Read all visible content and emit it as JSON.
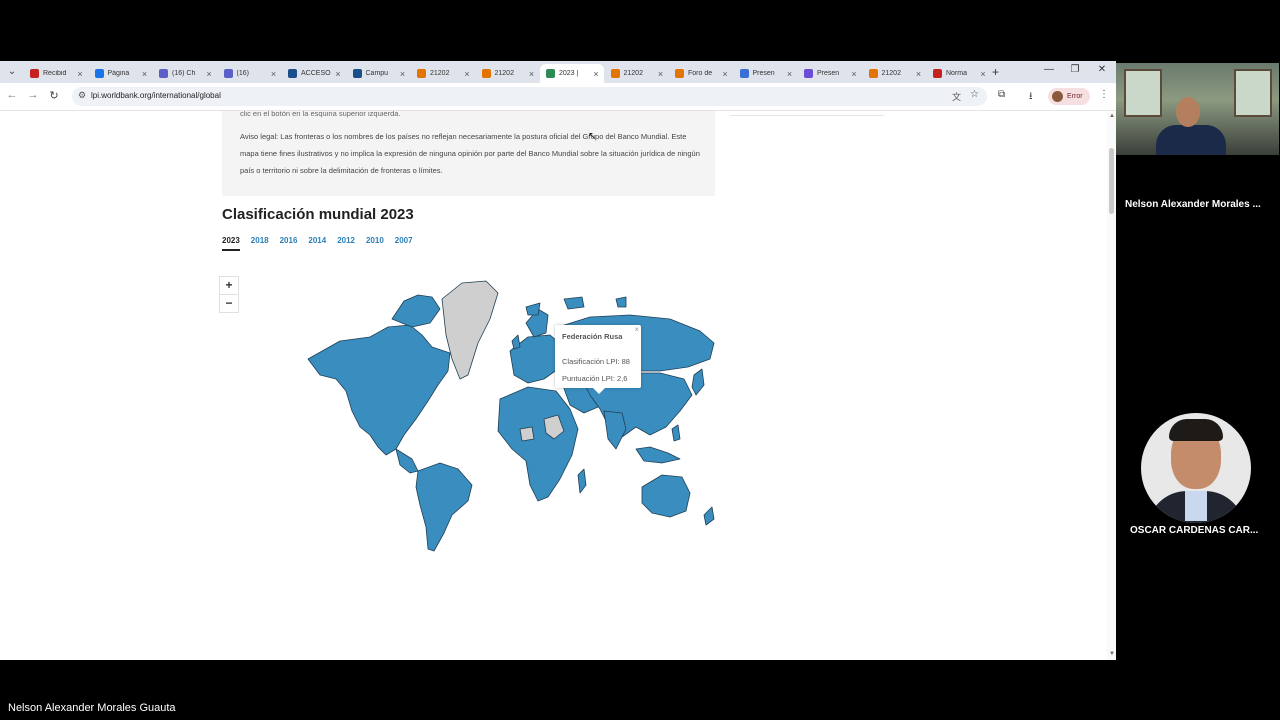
{
  "browser": {
    "tabs": [
      {
        "title": "Recibid",
        "color": "#c5221f"
      },
      {
        "title": "Página",
        "color": "#1a73e8"
      },
      {
        "title": "(16) Ch",
        "color": "#5b5fc7"
      },
      {
        "title": "(16)",
        "color": "#5b5fc7"
      },
      {
        "title": "ACCESO",
        "color": "#1a4f8a"
      },
      {
        "title": "Campu",
        "color": "#1a4f8a"
      },
      {
        "title": "21202",
        "color": "#e37400"
      },
      {
        "title": "21202",
        "color": "#e37400"
      },
      {
        "title": "2023 |",
        "color": "#2e8b57"
      },
      {
        "title": "21202",
        "color": "#e37400"
      },
      {
        "title": "Foro de",
        "color": "#e37400"
      },
      {
        "title": "Presen",
        "color": "#3b6fd6"
      },
      {
        "title": "Presen",
        "color": "#6a4fd6"
      },
      {
        "title": "21202",
        "color": "#e37400"
      },
      {
        "title": "Norma",
        "color": "#c5221f"
      }
    ],
    "url": "lpi.worldbank.org/international/global",
    "profile_status": "Error"
  },
  "page": {
    "top_fragment": "clic en el botón en la esquina superior izquierda.",
    "legal_notice": "Aviso legal: Las fronteras o los nombres de los países no reflejan necesariamente la postura oficial del Grupo del Banco Mundial. Este mapa tiene fines ilustrativos y no implica la expresión de ninguna opinión por parte del Banco Mundial sobre la situación jurídica de ningún país o territorio ni sobre la delimitación de fronteras o límites.",
    "section_title": "Clasificación mundial 2023",
    "year_tabs": [
      "2023",
      "2018",
      "2016",
      "2014",
      "2012",
      "2010",
      "2007"
    ],
    "active_year": "2023",
    "zoom_in": "+",
    "zoom_out": "−",
    "tooltip": {
      "country": "Federación Rusa",
      "rank_line": "Clasificación LPI: 88",
      "score_line": "Puntuación LPI: 2,6",
      "close": "×"
    },
    "map_colors": {
      "ranked": "#3a8dbf",
      "no_data": "#cfcfcf",
      "border": "#1f3f55"
    }
  },
  "meeting": {
    "participants": [
      {
        "name": "Nelson Alexander Morales ..."
      },
      {
        "name": "OSCAR CARDENAS CAR..."
      }
    ],
    "active_speaker": "Nelson Alexander Morales Guauta"
  }
}
